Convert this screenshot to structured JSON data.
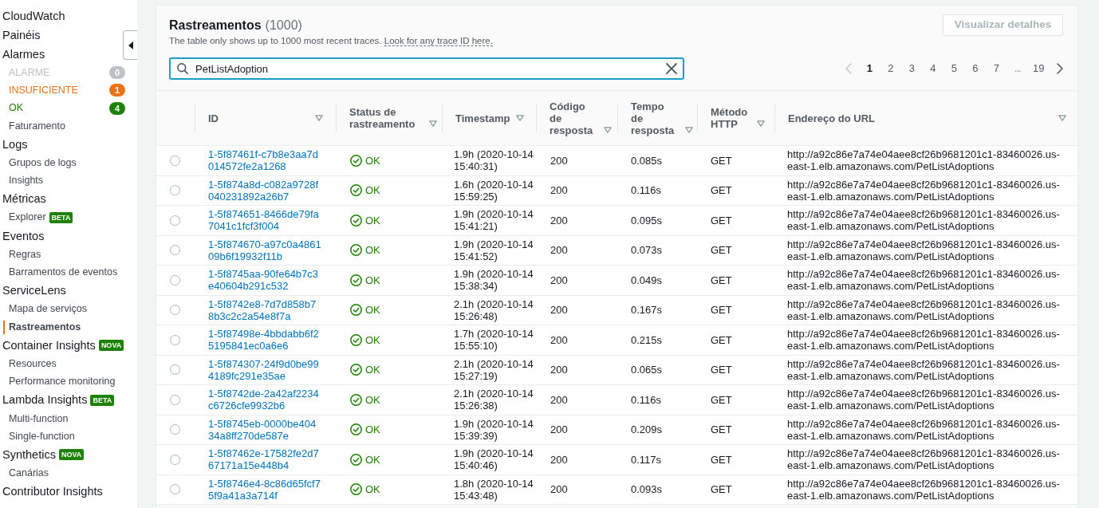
{
  "sidebar": {
    "items": [
      {
        "label": "CloudWatch",
        "selected": false
      },
      {
        "label": "Painéis",
        "selected": false
      },
      {
        "label": "Alarmes",
        "selected": false,
        "children": [
          {
            "label": "ALARME",
            "selected": false,
            "color": "#bcc2c3",
            "count": "0"
          },
          {
            "label": "INSUFICIENTE",
            "selected": false,
            "color": "#ec7211",
            "count": "1"
          },
          {
            "label": "OK",
            "selected": false,
            "color": "#1d8102",
            "count": "4"
          },
          {
            "label": "Faturamento",
            "selected": false
          }
        ]
      },
      {
        "label": "Logs",
        "selected": false,
        "children": [
          {
            "label": "Grupos de logs",
            "selected": false
          },
          {
            "label": "Insights",
            "selected": false
          }
        ]
      },
      {
        "label": "Métricas",
        "selected": false,
        "children": [
          {
            "label": "Explorer",
            "selected": false,
            "badge": "BETA"
          }
        ]
      },
      {
        "label": "Eventos",
        "selected": false,
        "children": [
          {
            "label": "Regras",
            "selected": false
          },
          {
            "label": "Barramentos de eventos",
            "selected": false
          }
        ]
      },
      {
        "label": "ServiceLens",
        "selected": false,
        "children": [
          {
            "label": "Mapa de serviços",
            "selected": false
          },
          {
            "label": "Rastreamentos",
            "selected": true
          }
        ]
      },
      {
        "label": "Container Insights",
        "selected": false,
        "badge": "NOVA",
        "children": [
          {
            "label": "Resources",
            "selected": false
          },
          {
            "label": "Performance monitoring",
            "selected": false
          }
        ]
      },
      {
        "label": "Lambda Insights",
        "selected": false,
        "badge": "BETA",
        "children": [
          {
            "label": "Multi-function",
            "selected": false
          },
          {
            "label": "Single-function",
            "selected": false
          }
        ]
      },
      {
        "label": "Synthetics",
        "selected": false,
        "badge": "NOVA",
        "children": [
          {
            "label": "Canárias",
            "selected": false
          }
        ]
      },
      {
        "label": "Contributor Insights",
        "selected": false
      }
    ]
  },
  "panel": {
    "title": "Rastreamentos",
    "count": "(1000)",
    "description": "The table only shows up to 1000 most recent traces.",
    "description_link": "Look for any trace ID here.",
    "details_button": {
      "label": "Visualizar detalhes",
      "disabled": true
    }
  },
  "search": {
    "value": "PetListAdoption"
  },
  "pagination": {
    "previous_disabled": true,
    "next_disabled": false,
    "pages": [
      {
        "label": "1",
        "kind": "page",
        "selected": true
      },
      {
        "label": "2",
        "kind": "page",
        "selected": false
      },
      {
        "label": "3",
        "kind": "page",
        "selected": false
      },
      {
        "label": "4",
        "kind": "page",
        "selected": false
      },
      {
        "label": "5",
        "kind": "page",
        "selected": false
      },
      {
        "label": "6",
        "kind": "page",
        "selected": false
      },
      {
        "label": "7",
        "kind": "page",
        "selected": false
      },
      {
        "label": "...",
        "kind": "ellipsis"
      },
      {
        "label": "19",
        "kind": "page",
        "selected": false
      }
    ]
  },
  "table": {
    "columns": [
      {
        "label": "ID",
        "sortable": true
      },
      {
        "label": "Status de rastreamento",
        "sortable": true
      },
      {
        "label": "Timestamp",
        "sortable": true
      },
      {
        "label": "Código de resposta",
        "sortable": true
      },
      {
        "label": "Tempo de resposta",
        "sortable": true
      },
      {
        "label": "Método HTTP",
        "sortable": true
      },
      {
        "label": "Endereço do URL",
        "sortable": true
      }
    ],
    "rows": [
      {
        "selected": false,
        "id": "1-5f87461f-c7b8e3aa7d014572fe2a1268",
        "status": {
          "label": "OK",
          "kind": "ok"
        },
        "timestamp": "1.9h (2020-10-14 15:40:31)",
        "response_code": "200",
        "response_time": "0.085s",
        "method": "GET",
        "url": "http://a92c86e7a74e04aee8cf26b9681201c1-83460026.us-east-1.elb.amazonaws.com/PetListAdoptions"
      },
      {
        "selected": false,
        "id": "1-5f874a8d-c082a9728f040231892a26b7",
        "status": {
          "label": "OK",
          "kind": "ok"
        },
        "timestamp": "1.6h (2020-10-14 15:59:25)",
        "response_code": "200",
        "response_time": "0.116s",
        "method": "GET",
        "url": "http://a92c86e7a74e04aee8cf26b9681201c1-83460026.us-east-1.elb.amazonaws.com/PetListAdoptions"
      },
      {
        "selected": false,
        "id": "1-5f874651-8466de79fa7041c1fcf3f004",
        "status": {
          "label": "OK",
          "kind": "ok"
        },
        "timestamp": "1.9h (2020-10-14 15:41:21)",
        "response_code": "200",
        "response_time": "0.095s",
        "method": "GET",
        "url": "http://a92c86e7a74e04aee8cf26b9681201c1-83460026.us-east-1.elb.amazonaws.com/PetListAdoptions"
      },
      {
        "selected": false,
        "id": "1-5f874670-a97c0a486109b6f19932f11b",
        "status": {
          "label": "OK",
          "kind": "ok"
        },
        "timestamp": "1.9h (2020-10-14 15:41:52)",
        "response_code": "200",
        "response_time": "0.073s",
        "method": "GET",
        "url": "http://a92c86e7a74e04aee8cf26b9681201c1-83460026.us-east-1.elb.amazonaws.com/PetListAdoptions"
      },
      {
        "selected": false,
        "id": "1-5f8745aa-90fe64b7c3e40604b291c532",
        "status": {
          "label": "OK",
          "kind": "ok"
        },
        "timestamp": "1.9h (2020-10-14 15:38:34)",
        "response_code": "200",
        "response_time": "0.049s",
        "method": "GET",
        "url": "http://a92c86e7a74e04aee8cf26b9681201c1-83460026.us-east-1.elb.amazonaws.com/PetListAdoptions"
      },
      {
        "selected": false,
        "id": "1-5f8742e8-7d7d858b78b3c2c2a54e8f7a",
        "status": {
          "label": "OK",
          "kind": "ok"
        },
        "timestamp": "2.1h (2020-10-14 15:26:48)",
        "response_code": "200",
        "response_time": "0.167s",
        "method": "GET",
        "url": "http://a92c86e7a74e04aee8cf26b9681201c1-83460026.us-east-1.elb.amazonaws.com/PetListAdoptions"
      },
      {
        "selected": false,
        "id": "1-5f87498e-4bbdabb6f25195841ec0a6e6",
        "status": {
          "label": "OK",
          "kind": "ok"
        },
        "timestamp": "1.7h (2020-10-14 15:55:10)",
        "response_code": "200",
        "response_time": "0.215s",
        "method": "GET",
        "url": "http://a92c86e7a74e04aee8cf26b9681201c1-83460026.us-east-1.elb.amazonaws.com/PetListAdoptions"
      },
      {
        "selected": false,
        "id": "1-5f874307-24f9d0be994189fc291e35ae",
        "status": {
          "label": "OK",
          "kind": "ok"
        },
        "timestamp": "2.1h (2020-10-14 15:27:19)",
        "response_code": "200",
        "response_time": "0.065s",
        "method": "GET",
        "url": "http://a92c86e7a74e04aee8cf26b9681201c1-83460026.us-east-1.elb.amazonaws.com/PetListAdoptions"
      },
      {
        "selected": false,
        "id": "1-5f8742de-2a42af2234c6726cfe9932b6",
        "status": {
          "label": "OK",
          "kind": "ok"
        },
        "timestamp": "2.1h (2020-10-14 15:26:38)",
        "response_code": "200",
        "response_time": "0.116s",
        "method": "GET",
        "url": "http://a92c86e7a74e04aee8cf26b9681201c1-83460026.us-east-1.elb.amazonaws.com/PetListAdoptions"
      },
      {
        "selected": false,
        "id": "1-5f8745eb-0000be40434a8ff270de587e",
        "status": {
          "label": "OK",
          "kind": "ok"
        },
        "timestamp": "1.9h (2020-10-14 15:39:39)",
        "response_code": "200",
        "response_time": "0.209s",
        "method": "GET",
        "url": "http://a92c86e7a74e04aee8cf26b9681201c1-83460026.us-east-1.elb.amazonaws.com/PetListAdoptions"
      },
      {
        "selected": false,
        "id": "1-5f87462e-17582fe2d767171a15e448b4",
        "status": {
          "label": "OK",
          "kind": "ok"
        },
        "timestamp": "1.9h (2020-10-14 15:40:46)",
        "response_code": "200",
        "response_time": "0.117s",
        "method": "GET",
        "url": "http://a92c86e7a74e04aee8cf26b9681201c1-83460026.us-east-1.elb.amazonaws.com/PetListAdoptions"
      },
      {
        "selected": false,
        "id": "1-5f8746e4-8c86d65fcf75f9a41a3a714f",
        "status": {
          "label": "OK",
          "kind": "ok"
        },
        "timestamp": "1.8h (2020-10-14 15:43:48)",
        "response_code": "200",
        "response_time": "0.093s",
        "method": "GET",
        "url": "http://a92c86e7a74e04aee8cf26b9681201c1-83460026.us-east-1.elb.amazonaws.com/PetListAdoptions"
      }
    ]
  }
}
